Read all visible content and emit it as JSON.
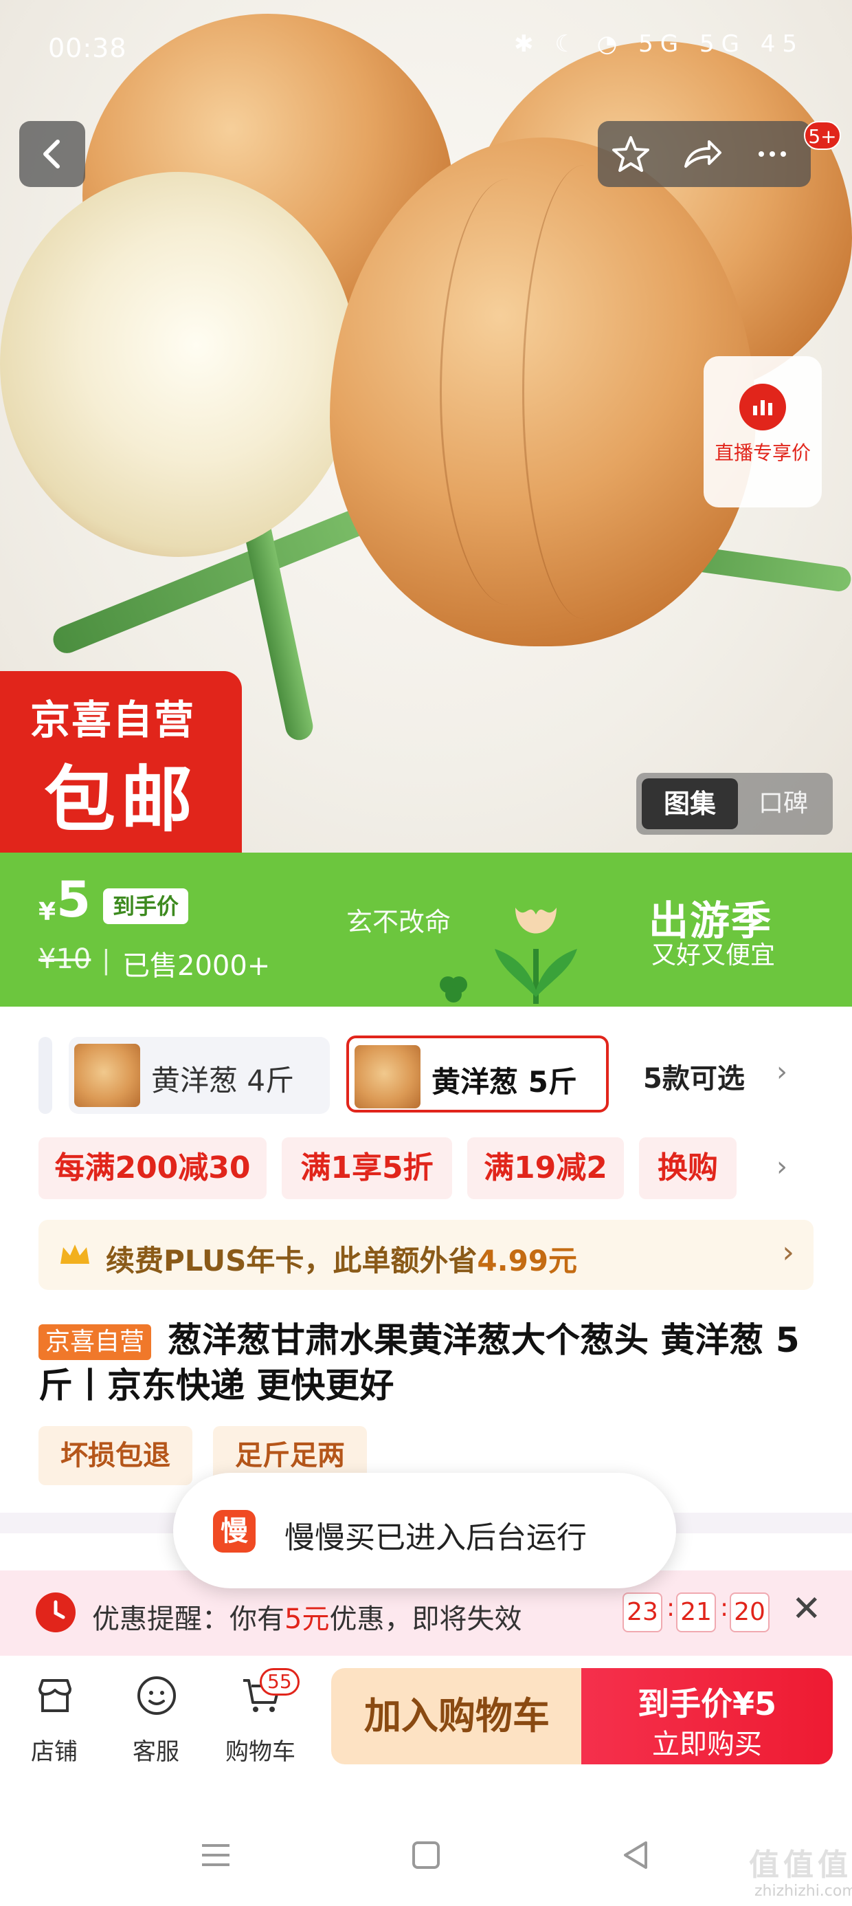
{
  "status_bar": {
    "time": "00:38",
    "icons": "✱ ☾ ◔ 5G 5G 45"
  },
  "top_actions": {
    "more_badge": "5+"
  },
  "live": {
    "label": "直播专享价"
  },
  "badge": {
    "line1": "京喜自营",
    "line2": "包邮"
  },
  "gallery_tabs": {
    "gallery": "图集",
    "review": "口碑"
  },
  "price": {
    "currency": "¥",
    "value": "5",
    "tag": "到手价",
    "original": "¥10",
    "separator": "|",
    "sold": "已售2000+",
    "promo_text": "玄不改命",
    "season_title": "出游季",
    "season_sub": "又好又便宜"
  },
  "variants": {
    "items": [
      {
        "label": "黄洋葱 4斤",
        "selected": false
      },
      {
        "label": "黄洋葱 5斤",
        "selected": true
      }
    ],
    "count_label": "5款可选",
    "more_icon": "chevron-right-icon"
  },
  "coupons": [
    "每满200减30",
    "满1享5折",
    "满19减2",
    "换购"
  ],
  "plus": {
    "text": "续费PLUS年卡，此单额外省",
    "amount": "4.99元"
  },
  "title": {
    "tag": "京喜自营",
    "text": "葱洋葱甘肃水果黄洋葱大个葱头 黄洋葱 5斤丨京东快递 更快更好"
  },
  "features": [
    "坏损包退",
    "足斤足两"
  ],
  "toast": {
    "icon_char": "慢",
    "text": "慢慢买已进入后台运行"
  },
  "reminder": {
    "prefix": "优惠提醒：你有",
    "amount": "5元",
    "suffix": "优惠，即将失效",
    "timer": [
      "23",
      "21",
      "20"
    ]
  },
  "bottom_bar": {
    "store": "店铺",
    "service": "客服",
    "cart": "购物车",
    "cart_count": "55",
    "add_cart": "加入购物车",
    "buy_price": "到手价¥5",
    "buy_label": "立即购买"
  },
  "watermark": {
    "text": "值值值",
    "sub": "zhizhizhi.com"
  },
  "colors": {
    "accent_red": "#e1251b",
    "band_green": "#6cc63e",
    "plus_bg": "#fdf6ea"
  }
}
